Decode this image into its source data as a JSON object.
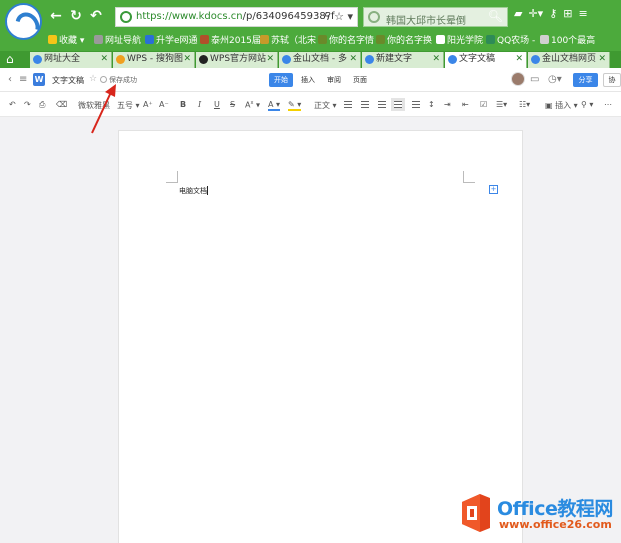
{
  "browser": {
    "url_green": "https://www.kdocs.cn",
    "url_rest": "/p/6340964593​8?f",
    "search_query": "韩国大邱市长晕倒",
    "colors": {
      "chrome": "#4caa3c",
      "tab_bar": "#3f9a31",
      "accent": "#3b86e8"
    }
  },
  "bookmarks": [
    {
      "label": "收藏",
      "icon": "star-icon",
      "color": "#f5c518"
    },
    {
      "label": "网址导航",
      "icon": "globe-icon",
      "color": "#8c8c8c"
    },
    {
      "label": "升学e网通",
      "icon": "e-icon",
      "color": "#2a6fd6"
    },
    {
      "label": "泰州2015届",
      "icon": "page-icon",
      "color": "#b0502a"
    },
    {
      "label": "苏轼（北宋",
      "icon": "page-icon",
      "color": "#c79a2a"
    },
    {
      "label": "你的名字情",
      "icon": "page-icon",
      "color": "#6a8a2a"
    },
    {
      "label": "你的名字换",
      "icon": "page-icon",
      "color": "#6a8a2a"
    },
    {
      "label": "阳光学院",
      "icon": "doc-icon",
      "color": "#ffffff"
    },
    {
      "label": "QQ农场 -",
      "icon": "qq-icon",
      "color": "#2e8b57"
    },
    {
      "label": "100个最高",
      "icon": "gear-icon",
      "color": "#c0c0c0"
    }
  ],
  "tabs": [
    {
      "label": "网址大全",
      "color": "#3b86e8"
    },
    {
      "label": "WPS - 搜狗图",
      "color": "#f0a020"
    },
    {
      "label": "WPS官方网站",
      "color": "#222222"
    },
    {
      "label": "金山文档 - 多",
      "color": "#3b86e8"
    },
    {
      "label": "新建文字",
      "color": "#3b86e8"
    },
    {
      "label": "文字文稿",
      "color": "#3b86e8"
    },
    {
      "label": "金山文档网页",
      "color": "#3b86e8"
    }
  ],
  "app": {
    "doc_title": "文字文稿",
    "save_status": "保存成功",
    "menu_tabs": [
      "开始",
      "插入",
      "审阅",
      "页面"
    ],
    "share_label": "分享",
    "more_label": "协"
  },
  "toolbar": {
    "font": "微软雅黑",
    "size": "五号",
    "grow": "A⁺",
    "shrink": "A⁻",
    "bold": "B",
    "italic": "I",
    "underline": "U",
    "strike": "S",
    "style": "正文",
    "insert": "插入"
  },
  "document": {
    "text": "电脑文档"
  },
  "watermark": {
    "title": "Office教程网",
    "url": "www.office26.com"
  }
}
